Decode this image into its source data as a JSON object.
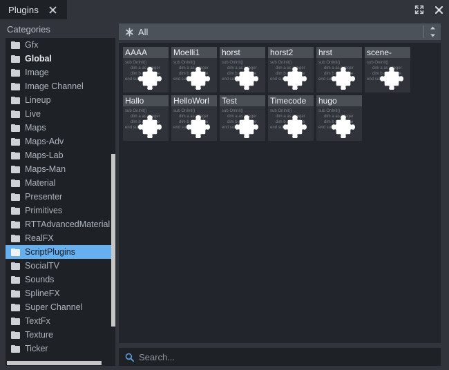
{
  "window": {
    "tab_label": "Plugins",
    "close_icon": "close-icon",
    "maximize_icon": "expand-icon",
    "window_close_icon": "close-icon"
  },
  "sidebar": {
    "title": "Categories",
    "items": [
      {
        "label": "Gfx",
        "state": "normal"
      },
      {
        "label": "Global",
        "state": "bold"
      },
      {
        "label": "Image",
        "state": "normal"
      },
      {
        "label": "Image Channel",
        "state": "normal"
      },
      {
        "label": "Lineup",
        "state": "normal"
      },
      {
        "label": "Live",
        "state": "normal"
      },
      {
        "label": "Maps",
        "state": "normal"
      },
      {
        "label": "Maps-Adv",
        "state": "normal"
      },
      {
        "label": "Maps-Lab",
        "state": "normal"
      },
      {
        "label": "Maps-Man",
        "state": "normal"
      },
      {
        "label": "Material",
        "state": "normal"
      },
      {
        "label": "Presenter",
        "state": "normal"
      },
      {
        "label": "Primitives",
        "state": "normal"
      },
      {
        "label": "RTTAdvancedMaterial",
        "state": "normal"
      },
      {
        "label": "RealFX",
        "state": "normal"
      },
      {
        "label": "ScriptPlugins",
        "state": "selected"
      },
      {
        "label": "SocialTV",
        "state": "normal"
      },
      {
        "label": "Sounds",
        "state": "normal"
      },
      {
        "label": "SplineFX",
        "state": "normal"
      },
      {
        "label": "Super Channel",
        "state": "normal"
      },
      {
        "label": "TextFx",
        "state": "normal"
      },
      {
        "label": "Texture",
        "state": "normal"
      },
      {
        "label": "Ticker",
        "state": "normal"
      }
    ]
  },
  "filter": {
    "icon": "asterisk-icon",
    "value": "All",
    "spinner_icon": "spinner-up-down-icon"
  },
  "plugins": {
    "code_preview": {
      "line1": "sub OnInit()",
      "line2": "dim a as integer",
      "line3": "dim b as double",
      "line4": "end sub"
    },
    "tile_icon": "puzzle-piece-icon",
    "items": [
      {
        "name": "AAAA"
      },
      {
        "name": "Moelli1"
      },
      {
        "name": "horst"
      },
      {
        "name": "horst2"
      },
      {
        "name": "hrst"
      },
      {
        "name": "scene-"
      },
      {
        "name": "Hallo"
      },
      {
        "name": "HelloWorl"
      },
      {
        "name": "Test"
      },
      {
        "name": "Timecode"
      },
      {
        "name": "hugo"
      }
    ]
  },
  "search": {
    "icon": "search-icon",
    "placeholder": "Search...",
    "value": ""
  },
  "colors": {
    "window_bg": "#31353b",
    "panel_bg": "#22262c",
    "list_bg": "#1e2227",
    "selection": "#67b0ef",
    "tile_bg": "#30343a",
    "tile_header": "#4a4f56",
    "combo_bg": "#4c525a",
    "search_icon": "#5b9fe0",
    "text": "#aeb5bd"
  }
}
